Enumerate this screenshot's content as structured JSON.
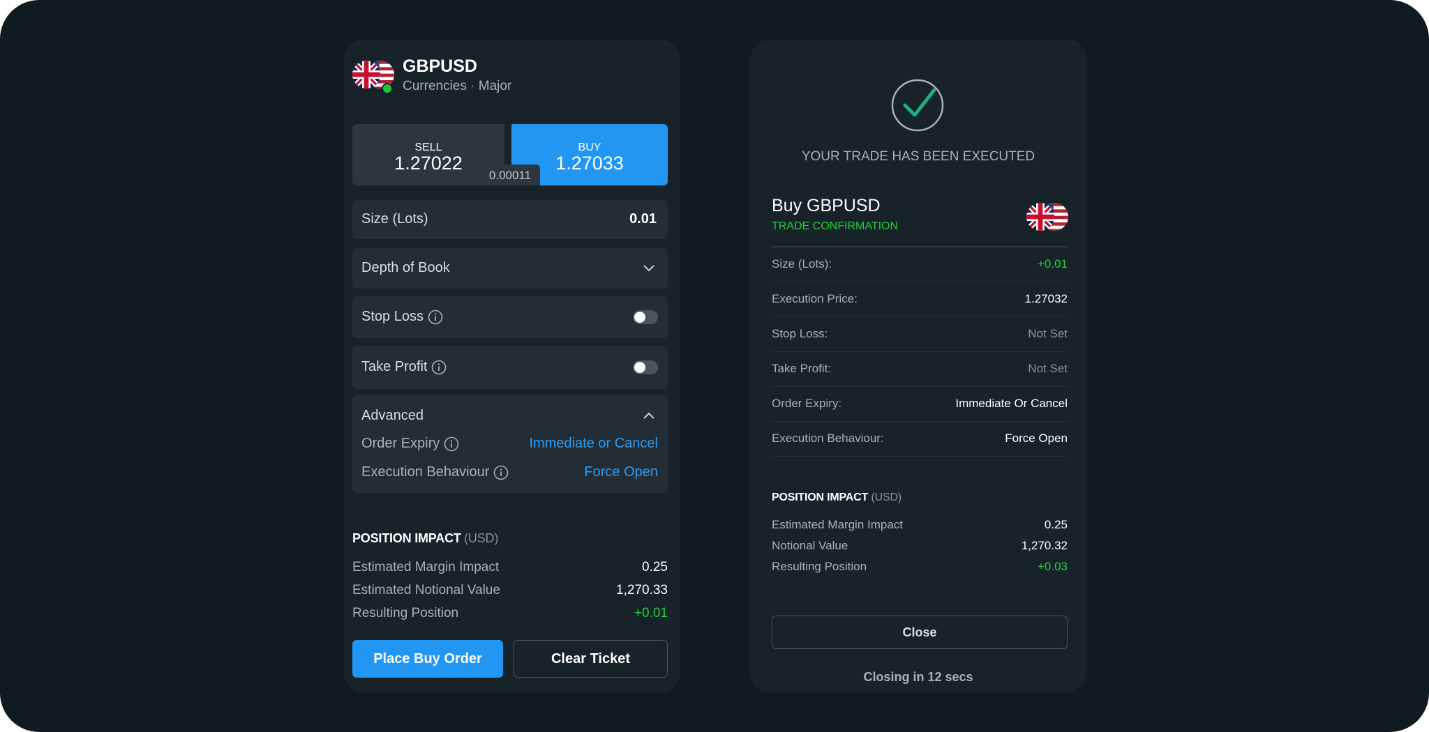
{
  "ticket": {
    "symbol": "GBPUSD",
    "category": "Currencies",
    "separator": "·",
    "subcategory": "Major",
    "sell": {
      "label": "SELL",
      "price": "1.27022"
    },
    "buy": {
      "label": "BUY",
      "price": "1.27033"
    },
    "spread": "0.00011",
    "size": {
      "label": "Size (Lots)",
      "value": "0.01"
    },
    "depth_of_book": {
      "label": "Depth of Book",
      "icon": "chevron-down-icon"
    },
    "stop_loss": {
      "label": "Stop Loss",
      "enabled": false
    },
    "take_profit": {
      "label": "Take Profit",
      "enabled": false
    },
    "advanced": {
      "label": "Advanced",
      "order_expiry": {
        "label": "Order Expiry",
        "value": "Immediate or Cancel"
      },
      "execution_behaviour": {
        "label": "Execution Behaviour",
        "value": "Force Open"
      }
    },
    "position_impact": {
      "title": "POSITION IMPACT",
      "unit": "(USD)",
      "rows": [
        {
          "label": "Estimated Margin Impact",
          "value": "0.25"
        },
        {
          "label": "Estimated Notional Value",
          "value": "1,270.33"
        },
        {
          "label": "Resulting Position",
          "value": "+0.01"
        }
      ]
    },
    "place_order_label": "Place Buy Order",
    "clear_ticket_label": "Clear Ticket"
  },
  "confirmation": {
    "status": "YOUR TRADE HAS BEEN EXECUTED",
    "title": "Buy GBPUSD",
    "subtitle": "TRADE CONFIRMATION",
    "details": [
      {
        "label": "Size (Lots):",
        "value": "+0.01"
      },
      {
        "label": "Execution Price:",
        "value": "1.27032"
      },
      {
        "label": "Stop Loss:",
        "value": "Not Set"
      },
      {
        "label": "Take Profit:",
        "value": "Not Set"
      },
      {
        "label": "Order Expiry:",
        "value": "Immediate Or Cancel"
      },
      {
        "label": "Execution Behaviour:",
        "value": "Force Open"
      }
    ],
    "position_impact": {
      "title": "POSITION IMPACT",
      "unit": "(USD)",
      "rows": [
        {
          "label": "Estimated Margin Impact",
          "value": "0.25"
        },
        {
          "label": "Notional Value",
          "value": "1,270.32"
        },
        {
          "label": "Resulting Position",
          "value": "+0.03"
        }
      ]
    },
    "close_label": "Close",
    "countdown": "Closing in 12 secs"
  },
  "colors": {
    "background": "#0f1a21",
    "panel": "#182229",
    "accent_blue": "#2196f3",
    "positive_green": "#21d13a"
  }
}
